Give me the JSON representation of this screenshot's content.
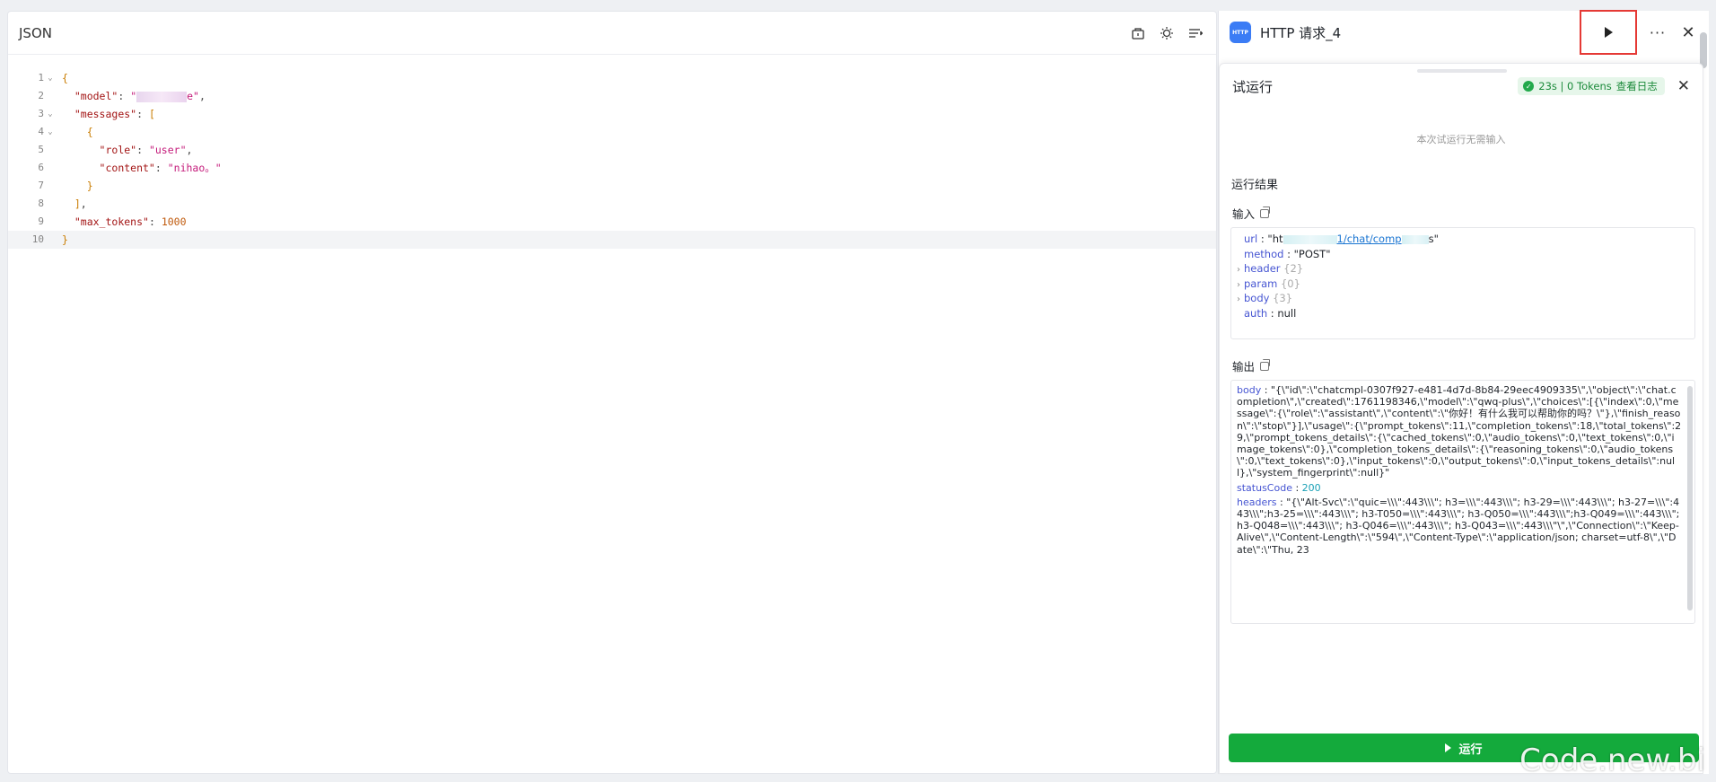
{
  "editor": {
    "title": "JSON",
    "tools": [
      "package-icon",
      "bulb-icon",
      "format-icon"
    ],
    "lines": [
      {
        "no": "1",
        "fold": true,
        "html": "<span class=\"tok-punc\">{</span>"
      },
      {
        "no": "2",
        "fold": false,
        "html": "  <span class=\"tok-key\">\"model\"</span><span class=\"tok-plain\">: </span><span class=\"tok-str\">\"<span class=\"redact\"></span>e\"</span><span class=\"tok-plain\">,</span>"
      },
      {
        "no": "3",
        "fold": true,
        "html": "  <span class=\"tok-key\">\"messages\"</span><span class=\"tok-plain\">: </span><span class=\"tok-punc\">[</span>"
      },
      {
        "no": "4",
        "fold": true,
        "html": "    <span class=\"tok-punc\">{</span>"
      },
      {
        "no": "5",
        "fold": false,
        "html": "      <span class=\"tok-key\">\"role\"</span><span class=\"tok-plain\">: </span><span class=\"tok-str\">\"user\"</span><span class=\"tok-plain\">,</span>"
      },
      {
        "no": "6",
        "fold": false,
        "html": "      <span class=\"tok-key\">\"content\"</span><span class=\"tok-plain\">: </span><span class=\"tok-str\">\"nihao。\"</span>"
      },
      {
        "no": "7",
        "fold": false,
        "html": "    <span class=\"tok-punc\">}</span>"
      },
      {
        "no": "8",
        "fold": false,
        "html": "  <span class=\"tok-punc\">]</span><span class=\"tok-plain\">,</span>"
      },
      {
        "no": "9",
        "fold": false,
        "html": "  <span class=\"tok-key\">\"max_tokens\"</span><span class=\"tok-plain\">: </span><span class=\"tok-num\">1000</span>"
      },
      {
        "no": "10",
        "fold": false,
        "html": "<span class=\"tok-punc\">}</span>",
        "active": true
      }
    ]
  },
  "node": {
    "title": "HTTP 请求_4",
    "logo_text": "HTTP"
  },
  "test_run": {
    "title": "试运行",
    "status_text": "23s | 0 Tokens",
    "log_link": "查看日志",
    "no_input_text": "本次试运行无需输入",
    "result_title": "运行结果",
    "input_title": "输入",
    "output_title": "输出",
    "input": {
      "url_key": "url",
      "url_prefix": "\"ht",
      "url_mid": "1/chat/comp",
      "url_suffix": "s\"",
      "method_key": "method",
      "method_val": "\"POST\"",
      "header_key": "header",
      "header_cnt": "{2}",
      "param_key": "param",
      "param_cnt": "{0}",
      "body_key": "body",
      "body_cnt": "{3}",
      "auth_key": "auth",
      "auth_val": "null"
    },
    "output": {
      "body_key": "body",
      "body_val": "\"{\\\"id\\\":\\\"chatcmpl-0307f927-e481-4d7d-8b84-29eec4909335\\\",\\\"object\\\":\\\"chat.completion\\\",\\\"created\\\":1761198346,\\\"model\\\":\\\"qwq-plus\\\",\\\"choices\\\":[{\\\"index\\\":0,\\\"message\\\":{\\\"role\\\":\\\"assistant\\\",\\\"content\\\":\\\"你好！有什么我可以帮助你的吗？\\\"},\\\"finish_reason\\\":\\\"stop\\\"}],\\\"usage\\\":{\\\"prompt_tokens\\\":11,\\\"completion_tokens\\\":18,\\\"total_tokens\\\":29,\\\"prompt_tokens_details\\\":{\\\"cached_tokens\\\":0,\\\"audio_tokens\\\":0,\\\"text_tokens\\\":0,\\\"image_tokens\\\":0},\\\"completion_tokens_details\\\":{\\\"reasoning_tokens\\\":0,\\\"audio_tokens\\\":0,\\\"text_tokens\\\":0},\\\"input_tokens\\\":0,\\\"output_tokens\\\":0,\\\"input_tokens_details\\\":null},\\\"system_fingerprint\\\":null}\"",
      "status_key": "statusCode",
      "status_val": "200",
      "headers_key": "headers",
      "headers_val": "\"{\\\"Alt-Svc\\\":\\\"quic=\\\\\\\":443\\\\\\\"; h3=\\\\\\\":443\\\\\\\"; h3-29=\\\\\\\":443\\\\\\\"; h3-27=\\\\\\\":443\\\\\\\";h3-25=\\\\\\\":443\\\\\\\"; h3-T050=\\\\\\\":443\\\\\\\"; h3-Q050=\\\\\\\":443\\\\\\\";h3-Q049=\\\\\\\":443\\\\\\\";h3-Q048=\\\\\\\":443\\\\\\\"; h3-Q046=\\\\\\\":443\\\\\\\"; h3-Q043=\\\\\\\":443\\\\\\\"\\\",\\\"Connection\\\":\\\"Keep-Alive\\\",\\\"Content-Length\\\":\\\"594\\\",\\\"Content-Type\\\":\\\"application/json; charset=utf-8\\\",\\\"Date\\\":\\\"Thu, 23"
    },
    "run_button": "运行"
  },
  "watermark": "Code.new.bi",
  "colors": {
    "accent_green": "#14aa3c",
    "highlight_red": "#e53935",
    "link_blue": "#1874d1"
  }
}
